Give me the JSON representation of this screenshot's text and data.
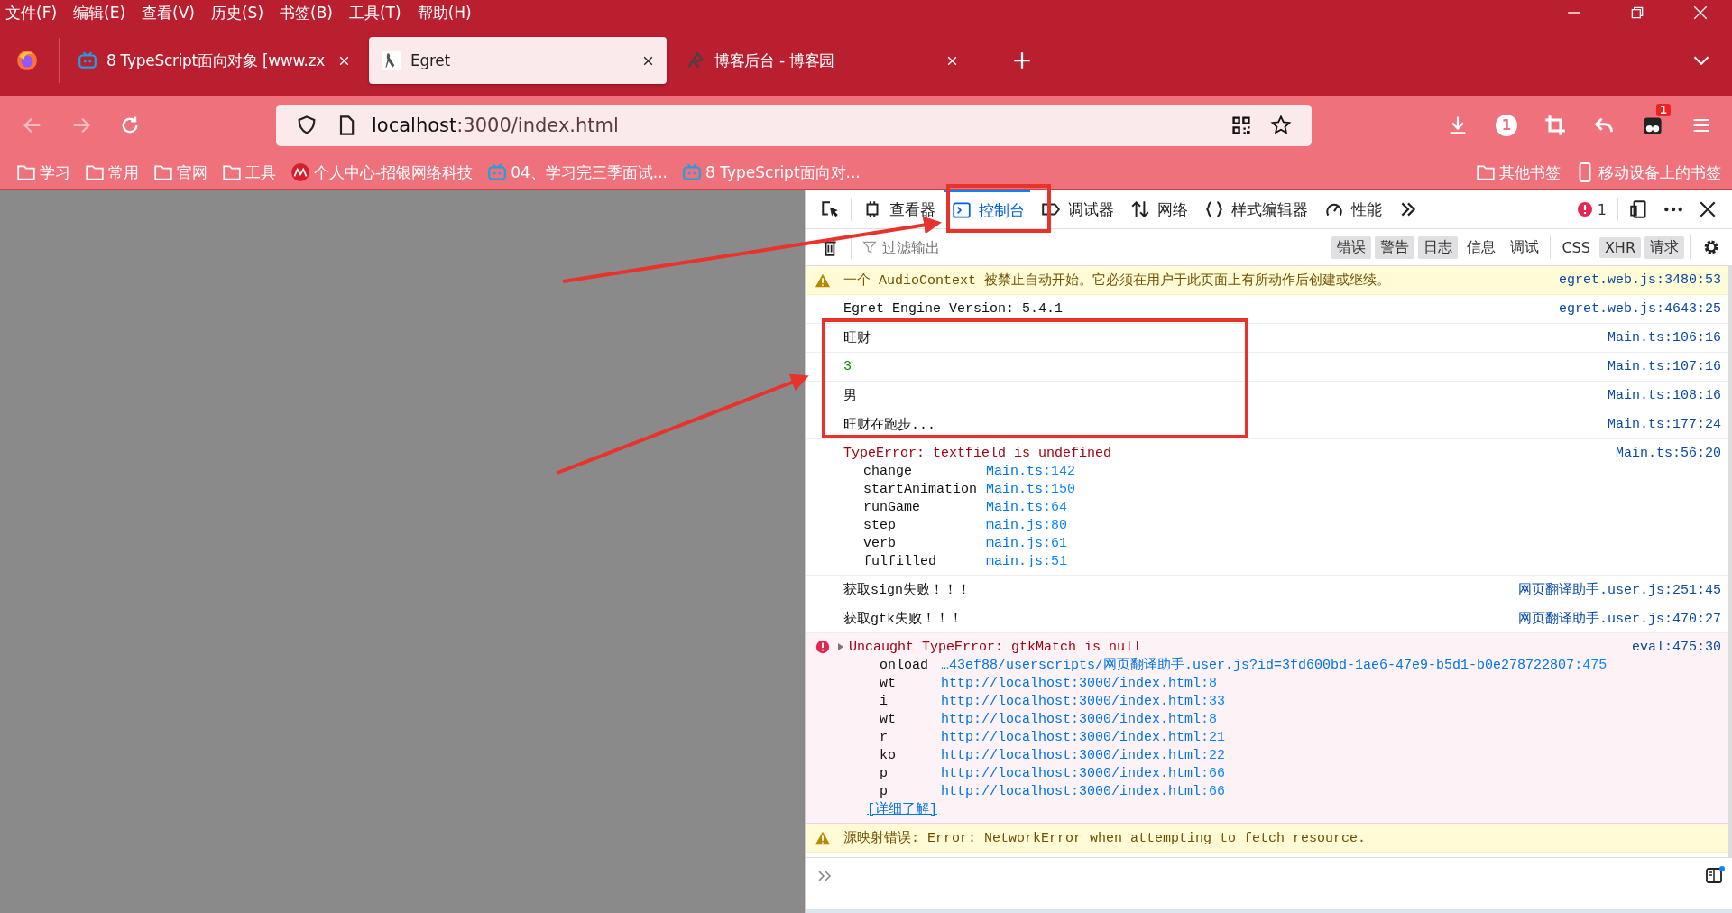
{
  "menu_bar": [
    "文件(F)",
    "编辑(E)",
    "查看(V)",
    "历史(S)",
    "书签(B)",
    "工具(T)",
    "帮助(H)"
  ],
  "tabs": [
    {
      "title": "8 TypeScript面向对象 [www.zx",
      "selected": false
    },
    {
      "title": "Egret",
      "selected": true
    },
    {
      "title": "博客后台 - 博客园",
      "selected": false
    }
  ],
  "address_bar": {
    "host": "localhost",
    "rest": ":3000/index.html"
  },
  "toolbar": {
    "notification_count": "1",
    "extension_badge": "1"
  },
  "bookmarks": [
    {
      "label": "学习",
      "kind": "folder"
    },
    {
      "label": "常用",
      "kind": "folder"
    },
    {
      "label": "官网",
      "kind": "folder"
    },
    {
      "label": "工具",
      "kind": "folder"
    },
    {
      "label": "个人中心-招银网络科技",
      "kind": "site"
    },
    {
      "label": "04、学习完三季面试...",
      "kind": "video"
    },
    {
      "label": "8 TypeScript面向对...",
      "kind": "video"
    }
  ],
  "bookmarks_right": [
    {
      "label": "其他书签",
      "kind": "folder"
    },
    {
      "label": "移动设备上的书签",
      "kind": "mobile"
    }
  ],
  "devtools": {
    "tabs": [
      {
        "label": "查看器",
        "selected": false
      },
      {
        "label": "控制台",
        "selected": true
      },
      {
        "label": "调试器",
        "selected": false
      },
      {
        "label": "网络",
        "selected": false
      },
      {
        "label": "样式编辑器",
        "selected": false
      },
      {
        "label": "性能",
        "selected": false
      }
    ],
    "error_count": "1",
    "filter": {
      "placeholder": "过滤输出"
    },
    "levels": [
      {
        "label": "错误",
        "on": true
      },
      {
        "label": "警告",
        "on": true
      },
      {
        "label": "日志",
        "on": true
      },
      {
        "label": "信息",
        "on": false
      },
      {
        "label": "调试",
        "on": false
      }
    ],
    "requests": [
      {
        "label": "CSS",
        "on": false
      },
      {
        "label": "XHR",
        "on": true
      },
      {
        "label": "请求",
        "on": true
      }
    ],
    "messages": [
      {
        "kind": "warning",
        "text": "一个 AudioContext 被禁止自动开始。它必须在用户于此页面上有所动作后创建或继续。",
        "source": "egret.web.js:3480:53"
      },
      {
        "kind": "log",
        "text": "Egret Engine Version: 5.4.1",
        "source": "egret.web.js:4643:25"
      },
      {
        "kind": "log",
        "text": "旺财",
        "source": "Main.ts:106:16"
      },
      {
        "kind": "number",
        "text": "3",
        "source": "Main.ts:107:16"
      },
      {
        "kind": "log",
        "text": "男",
        "source": "Main.ts:108:16"
      },
      {
        "kind": "log",
        "text": "旺财在跑步...",
        "source": "Main.ts:177:24"
      },
      {
        "kind": "error",
        "text": "TypeError: textfield is undefined",
        "source": "Main.ts:56:20",
        "stack": [
          {
            "name": "change",
            "file": "Main.ts",
            "line": ":142"
          },
          {
            "name": "startAnimation",
            "file": "Main.ts",
            "line": ":150"
          },
          {
            "name": "runGame",
            "file": "Main.ts",
            "line": ":64"
          },
          {
            "name": "step",
            "file": "main.js",
            "line": ":80"
          },
          {
            "name": "verb",
            "file": "main.js",
            "line": ":61"
          },
          {
            "name": "fulfilled",
            "file": "main.js",
            "line": ":51"
          }
        ]
      },
      {
        "kind": "log",
        "text": "获取sign失败！！！",
        "source": "网页翻译助手.user.js:251:45"
      },
      {
        "kind": "log",
        "text": "获取gtk失败！！！",
        "source": "网页翻译助手.user.js:470:27"
      },
      {
        "kind": "uncaught",
        "text": "Uncaught TypeError: gtkMatch is null",
        "source": "eval:475:30",
        "stack": [
          {
            "name": "onload",
            "file": "…43ef88/userscripts/网页翻译助手.user.js?id=3fd600bd-1ae6-47e9-b5d1-b0e278722807",
            "line": ":475"
          },
          {
            "name": "wt",
            "file": "http://localhost:3000/index.html",
            "line": ":8"
          },
          {
            "name": "i",
            "file": "http://localhost:3000/index.html",
            "line": ":33"
          },
          {
            "name": "wt",
            "file": "http://localhost:3000/index.html",
            "line": ":8"
          },
          {
            "name": "r",
            "file": "http://localhost:3000/index.html",
            "line": ":21"
          },
          {
            "name": "ko",
            "file": "http://localhost:3000/index.html",
            "line": ":22"
          },
          {
            "name": "p",
            "file": "http://localhost:3000/index.html",
            "line": ":66"
          },
          {
            "name": "p",
            "file": "http://localhost:3000/index.html",
            "line": ":66"
          }
        ],
        "link": "[详细了解]"
      },
      {
        "kind": "warning",
        "text": "源映射错误: Error: NetworkError when attempting to fetch resource."
      }
    ]
  }
}
